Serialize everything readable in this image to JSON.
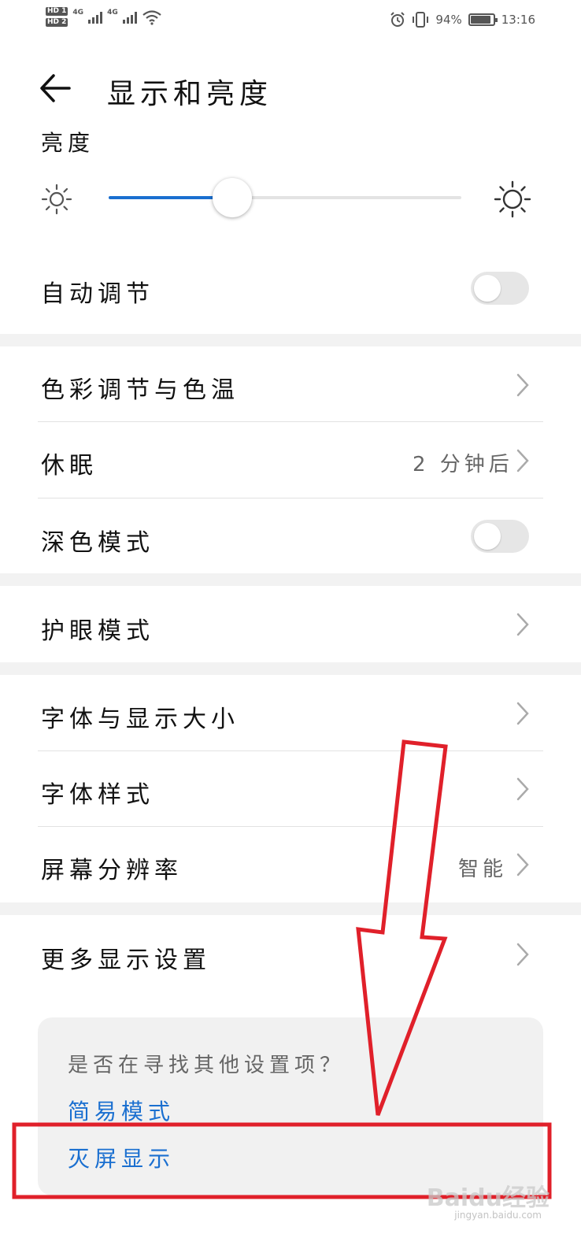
{
  "status_bar": {
    "hd1": "HD 1",
    "hd2": "HD 2",
    "network_1": "4G",
    "network_2": "4G",
    "battery": "94%",
    "time": "13:16",
    "icons": [
      "alarm-icon",
      "vibrate-icon",
      "wifi-icon",
      "signal-icon",
      "battery-icon"
    ]
  },
  "header": {
    "title": "显示和亮度",
    "back_icon": "arrow-left-icon"
  },
  "brightness": {
    "label": "亮度",
    "level": 0.35,
    "min_icon": "sun-small-icon",
    "max_icon": "sun-large-icon",
    "accent_color": "#1a6fd0"
  },
  "auto_adjust": {
    "label": "自动调节",
    "enabled": false
  },
  "items": {
    "color_temp": {
      "label": "色彩调节与色温"
    },
    "sleep": {
      "label": "休眠",
      "value": "2 分钟后"
    },
    "dark_mode": {
      "label": "深色模式",
      "enabled": false
    },
    "eye_care": {
      "label": "护眼模式"
    },
    "font_size": {
      "label": "字体与显示大小"
    },
    "font_style": {
      "label": "字体样式"
    },
    "resolution": {
      "label": "屏幕分辨率",
      "value": "智能"
    },
    "more_display": {
      "label": "更多显示设置"
    }
  },
  "hint": {
    "question": "是否在寻找其他设置项？",
    "links": [
      "简易模式",
      "灭屏显示"
    ],
    "link_color": "#1a6fd0"
  },
  "annotation": {
    "color": "#e0202a",
    "shapes": [
      "down-arrow",
      "highlight-rectangle"
    ]
  },
  "watermark": {
    "text": "Baidu经验",
    "subtext": "jingyan.baidu.com"
  }
}
